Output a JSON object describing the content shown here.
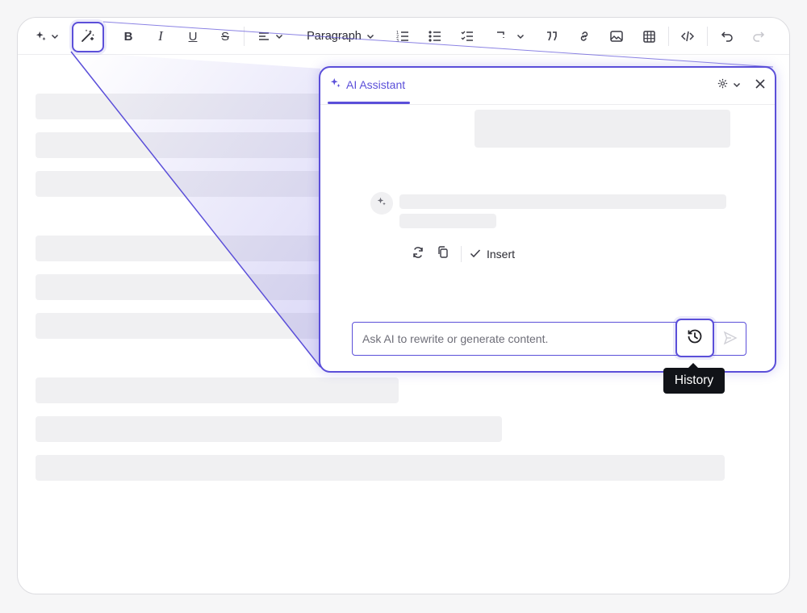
{
  "toolbar": {
    "ai_menu_icon": "sparkles-icon",
    "ai_wand_icon": "magic-wand-icon",
    "bold_label": "B",
    "italic_label": "I",
    "underline_label": "U",
    "strike_label": "S",
    "align_icon": "align-left-icon",
    "paragraph_label": "Paragraph",
    "icons": [
      "ordered-list-icon",
      "bullet-list-icon",
      "todo-list-icon",
      "code-block-icon",
      "blockquote-icon",
      "link-icon",
      "image-icon",
      "table-icon",
      "source-code-icon",
      "undo-icon",
      "redo-icon"
    ]
  },
  "assistant": {
    "title": "AI Assistant",
    "settings_icon": "gear-icon",
    "close_icon": "close-icon",
    "insert_label": "Insert",
    "input_placeholder": "Ask AI to rewrite or generate content.",
    "history_icon": "history-icon",
    "send_icon": "send-icon"
  },
  "tooltip": {
    "history_label": "History"
  },
  "colors": {
    "accent": "#5b4fd9",
    "tooltip_bg": "#111318",
    "skeleton": "#f0f0f2"
  }
}
